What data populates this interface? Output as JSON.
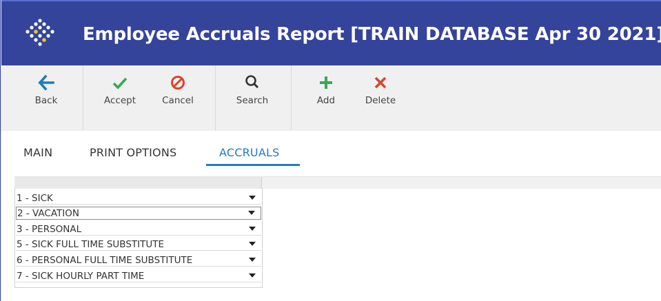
{
  "window": {
    "title": "Employee Accruals Report [TRAIN DATABASE Apr 30 2021]",
    "logo_icon": "dotted-diamond-logo",
    "colors": {
      "titlebar": "#34449b",
      "accent": "#1f7bbf",
      "back": "#1f7bbf",
      "accept": "#3aa655",
      "cancel": "#d9452c",
      "add": "#3aa655",
      "delete": "#d9452c"
    }
  },
  "toolbar": {
    "back_label": "Back",
    "accept_label": "Accept",
    "cancel_label": "Cancel",
    "search_label": "Search",
    "add_label": "Add",
    "delete_label": "Delete"
  },
  "tabs": [
    {
      "label": "MAIN",
      "active": false
    },
    {
      "label": "PRINT OPTIONS",
      "active": false
    },
    {
      "label": "ACCRUALS",
      "active": true
    }
  ],
  "accruals": {
    "rows": [
      {
        "label": "1 - SICK"
      },
      {
        "label": "2 - VACATION",
        "selected": true
      },
      {
        "label": "3 - PERSONAL"
      },
      {
        "label": "5 - SICK FULL TIME SUBSTITUTE"
      },
      {
        "label": "6 - PERSONAL FULL TIME SUBSTITUTE"
      },
      {
        "label": "7 - SICK HOURLY PART TIME"
      }
    ]
  }
}
